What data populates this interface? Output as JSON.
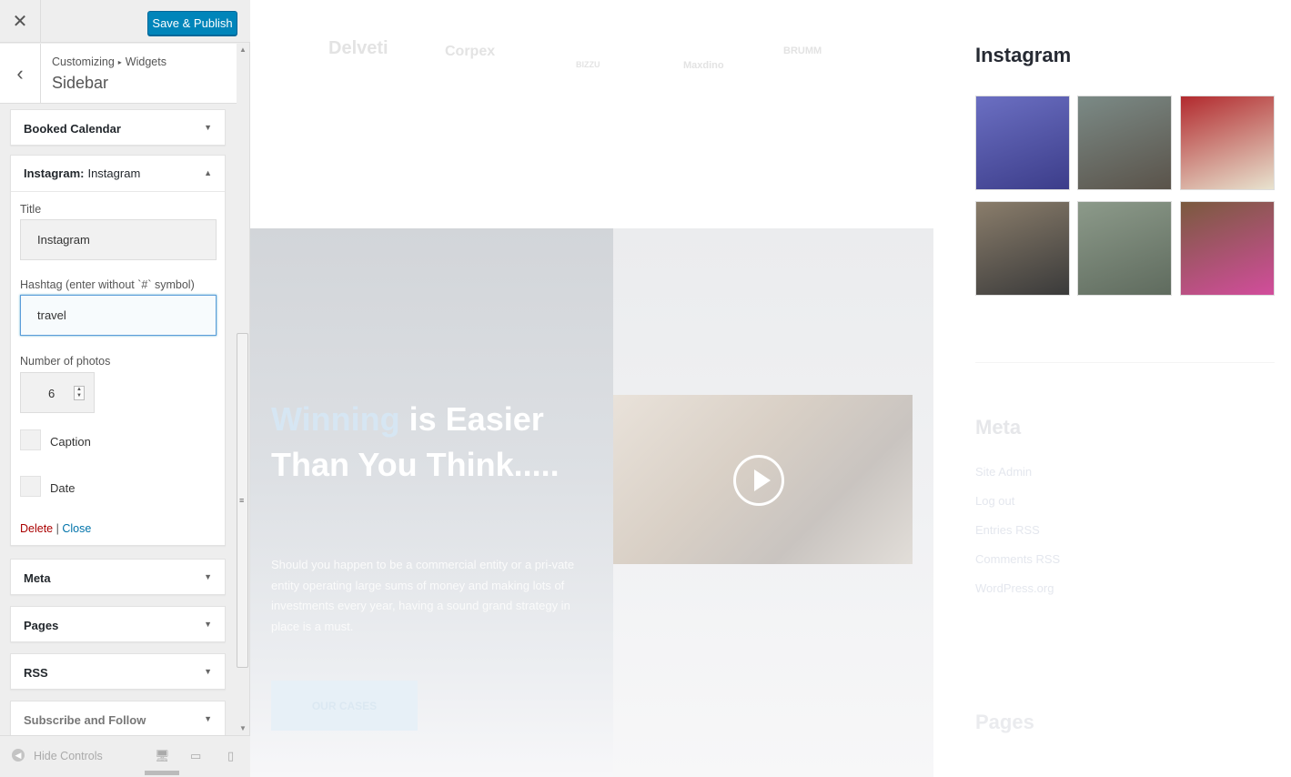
{
  "panel": {
    "close_icon": "close-icon",
    "save_label": "Save & Publish",
    "breadcrumb": [
      "Customizing",
      "Widgets"
    ],
    "section_title": "Sidebar",
    "widgets": {
      "booked_calendar": "Booked Calendar",
      "instagram": {
        "name": "Instagram:",
        "subtitle": "Instagram",
        "title_label": "Title",
        "title_value": "Instagram",
        "hashtag_label": "Hashtag (enter without `#` symbol)",
        "hashtag_value": "travel",
        "photos_label": "Number of photos",
        "photos_value": "6",
        "caption_label": "Caption",
        "date_label": "Date",
        "delete_label": "Delete",
        "separator": "|",
        "close_label": "Close"
      },
      "meta": "Meta",
      "pages": "Pages",
      "rss": "RSS",
      "subscribe": "Subscribe and Follow"
    },
    "footer": {
      "hide_label": "Hide Controls"
    }
  },
  "preview": {
    "logos": [
      "Delveti",
      "Corpex",
      "BIZZU",
      "Maxdino",
      "BRUMM"
    ],
    "hero": {
      "title_accent": "Winning",
      "title_rest": " is Easier Than You Think.....",
      "text": "Should you happen to be a commercial entity or a pri-vate entity operating large sums of money and making lots of investments every year, having a sound grand strategy in place is a must.",
      "button": "OUR CASES"
    }
  },
  "sidebar_preview": {
    "instagram_title": "Instagram",
    "photos": [
      {
        "colors": [
          "#6b6fc2",
          "#3c3d8a"
        ]
      },
      {
        "colors": [
          "#7b8a86",
          "#5a534a"
        ]
      },
      {
        "colors": [
          "#b22a2e",
          "#e8e3cf"
        ]
      },
      {
        "colors": [
          "#8a7d6b",
          "#3a3a3a"
        ]
      },
      {
        "colors": [
          "#8c9a8a",
          "#5f6b5e"
        ]
      },
      {
        "colors": [
          "#7a5a3e",
          "#d24d9c"
        ]
      }
    ],
    "meta_title": "Meta",
    "meta_links": [
      "Site Admin",
      "Log out",
      "Entries RSS",
      "Comments RSS",
      "WordPress.org"
    ],
    "pages_title": "Pages"
  }
}
